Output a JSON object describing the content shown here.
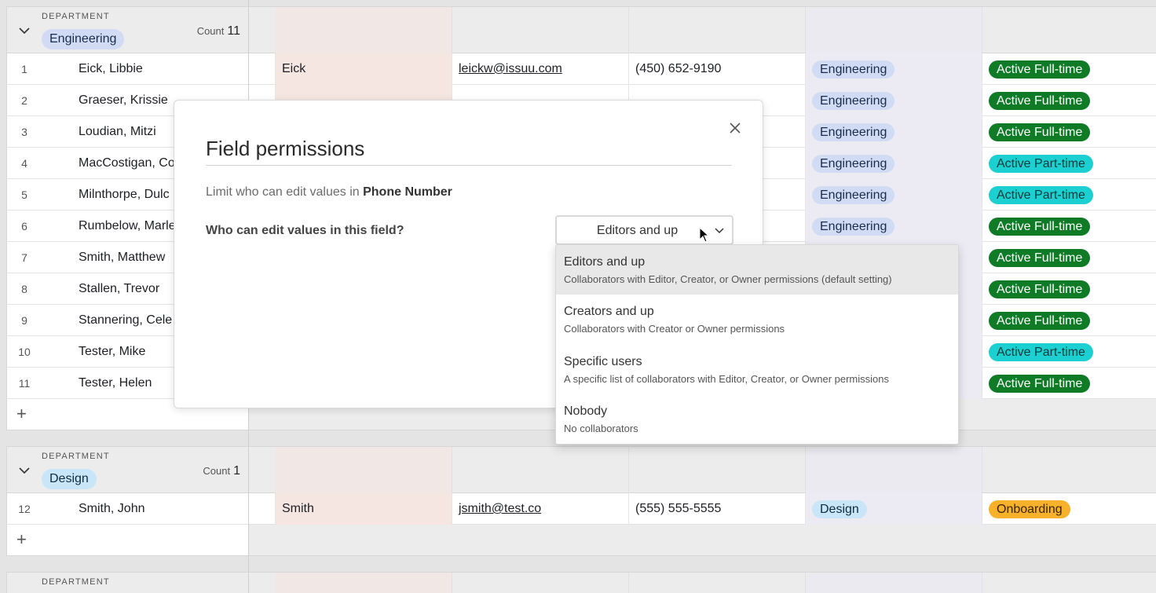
{
  "groups": [
    {
      "field_label": "DEPARTMENT",
      "name": "Engineering",
      "count_label": "Count",
      "count": "11",
      "rows": [
        {
          "num": "1",
          "name": "Eick, Libbie",
          "last": "Eick",
          "email": "leickw@issuu.com",
          "phone": "(450) 652-9190",
          "dept": "Engineering",
          "status": "Active Full-time"
        },
        {
          "num": "2",
          "name": "Graeser, Krissie",
          "last": "",
          "email": "",
          "phone": "",
          "dept": "Engineering",
          "status": "Active Full-time"
        },
        {
          "num": "3",
          "name": "Loudian, Mitzi",
          "last": "",
          "email": "",
          "phone": "",
          "dept": "Engineering",
          "status": "Active Full-time"
        },
        {
          "num": "4",
          "name": "MacCostigan, Co",
          "last": "",
          "email": "",
          "phone": "",
          "dept": "Engineering",
          "status": "Active Part-time"
        },
        {
          "num": "5",
          "name": "Milnthorpe, Dulc",
          "last": "",
          "email": "",
          "phone": "",
          "dept": "Engineering",
          "status": "Active Part-time"
        },
        {
          "num": "6",
          "name": "Rumbelow, Marle",
          "last": "",
          "email": "",
          "phone": "",
          "dept": "Engineering",
          "status": "Active Full-time"
        },
        {
          "num": "7",
          "name": "Smith, Matthew",
          "last": "",
          "email": "",
          "phone": "",
          "dept": "",
          "status": "Active Full-time"
        },
        {
          "num": "8",
          "name": "Stallen, Trevor",
          "last": "",
          "email": "",
          "phone": "",
          "dept": "",
          "status": "Active Full-time"
        },
        {
          "num": "9",
          "name": "Stannering, Cele",
          "last": "",
          "email": "",
          "phone": "",
          "dept": "",
          "status": "Active Full-time"
        },
        {
          "num": "10",
          "name": "Tester, Mike",
          "last": "",
          "email": "",
          "phone": "",
          "dept": "",
          "status": "Active Part-time"
        },
        {
          "num": "11",
          "name": "Tester, Helen",
          "last": "",
          "email": "",
          "phone": "",
          "dept": "",
          "status": "Active Full-time"
        }
      ]
    },
    {
      "field_label": "DEPARTMENT",
      "name": "Design",
      "count_label": "Count",
      "count": "1",
      "rows": [
        {
          "num": "12",
          "name": "Smith, John",
          "last": "Smith",
          "email": "jsmith@test.co",
          "phone": "(555) 555-5555",
          "dept": "Design",
          "status": "Onboarding"
        }
      ]
    },
    {
      "field_label": "DEPARTMENT"
    }
  ],
  "modal": {
    "title": "Field permissions",
    "desc_prefix": "Limit who can edit values in ",
    "field_name": "Phone Number",
    "question": "Who can edit values in this field?",
    "selected_value": "Editors and up"
  },
  "dropdown": {
    "options": [
      {
        "title": "Editors and up",
        "subtitle": "Collaborators with Editor, Creator, or Owner permissions (default setting)"
      },
      {
        "title": "Creators and up",
        "subtitle": "Collaborators with Creator or Owner permissions"
      },
      {
        "title": "Specific users",
        "subtitle": "A specific list of collaborators with Editor, Creator, or Owner permissions"
      },
      {
        "title": "Nobody",
        "subtitle": "No collaborators"
      }
    ]
  },
  "icons": {
    "group_toggle": "chevron-down-icon",
    "add_row": "plus-icon",
    "close": "close-icon",
    "select_toggle": "chevron-down-icon",
    "pointer": "mouse-cursor-icon"
  },
  "colors": {
    "engineering_pill": "#d1dcf4",
    "design_pill": "#c8e6f7",
    "active_full_time": "#0f7b26",
    "active_part_time": "#1ccfd0",
    "onboarding": "#f7b12a"
  }
}
